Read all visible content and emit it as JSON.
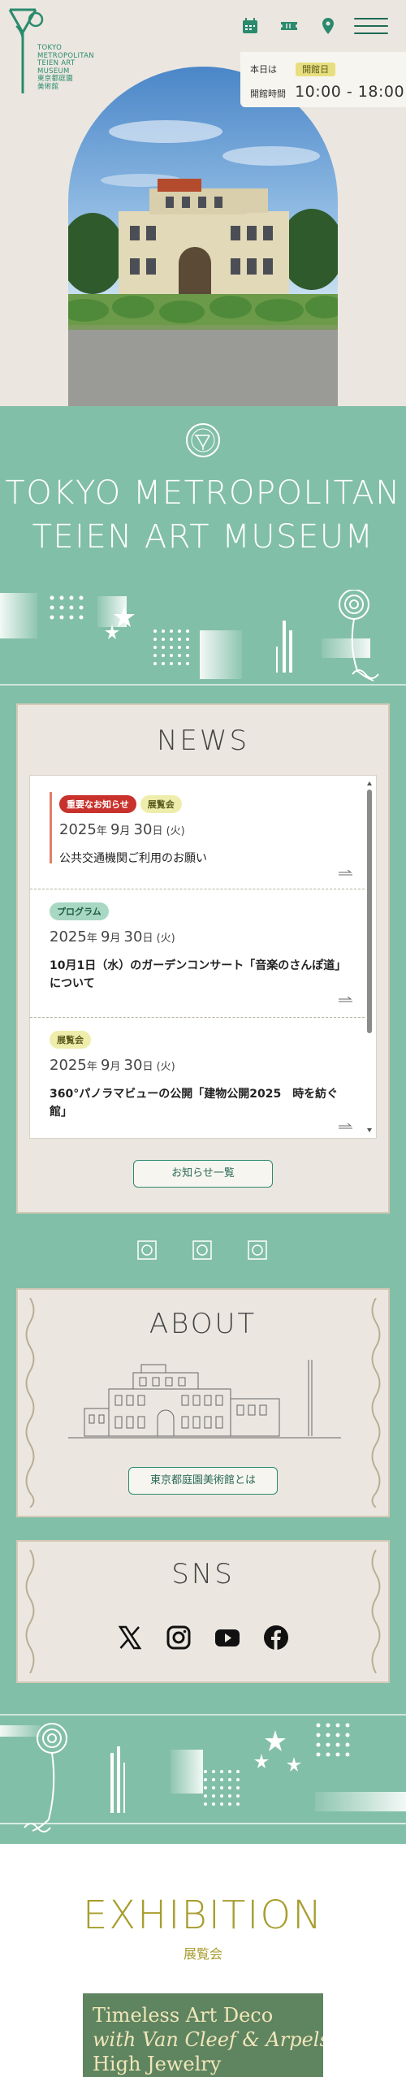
{
  "header": {
    "logo_lines": [
      "TOKYO",
      "METROPOLITAN",
      "TEIEN ART",
      "MUSEUM",
      "東京都庭園",
      "美術館"
    ],
    "icons": [
      "calendar-icon",
      "ticket-icon",
      "map-pin-icon",
      "menu-icon"
    ],
    "hours": {
      "today_label": "本日は",
      "status": "開館日",
      "hours_label": "開館時間",
      "hours_value": "10:00 - 18:00"
    }
  },
  "hero": {
    "controls": {
      "pause_icon": "pause-icon"
    }
  },
  "museum_title": {
    "line1": "TOKYO METROPOLITAN",
    "line2": "TEIEN ART MUSEUM"
  },
  "news": {
    "heading": "NEWS",
    "items": [
      {
        "tags": [
          "重要なお知らせ",
          "展覧会"
        ],
        "year": "2025",
        "month": "9",
        "day": "30",
        "dow": "(火)",
        "title": "公共交通機関ご利用のお願い"
      },
      {
        "tags": [
          "プログラム"
        ],
        "year": "2025",
        "month": "9",
        "day": "30",
        "dow": "(火)",
        "title": "10月1日（水）のガーデンコンサート「音楽のさんぽ道」について"
      },
      {
        "tags": [
          "展覧会"
        ],
        "year": "2025",
        "month": "9",
        "day": "30",
        "dow": "(火)",
        "title": "360°パノラマビューの公開「建物公開2025　時を紡ぐ館」"
      }
    ],
    "more_label": "お知らせ一覧"
  },
  "about": {
    "heading": "ABOUT",
    "button_label": "東京都庭園美術館とは"
  },
  "sns": {
    "heading": "SNS",
    "icons": [
      "x-icon",
      "instagram-icon",
      "youtube-icon",
      "facebook-icon"
    ]
  },
  "exhibition": {
    "heading": "EXHIBITION",
    "subheading": "展覧会",
    "card_lines": [
      "Timeless Art Deco",
      "with Van Cleef & Arpels",
      "High Jewelry"
    ]
  },
  "colors": {
    "green": "#82bfa8",
    "beige": "#ebe7e0",
    "accent": "#2b8a6e",
    "gold": "#a89d2e",
    "red": "#c8312c"
  }
}
